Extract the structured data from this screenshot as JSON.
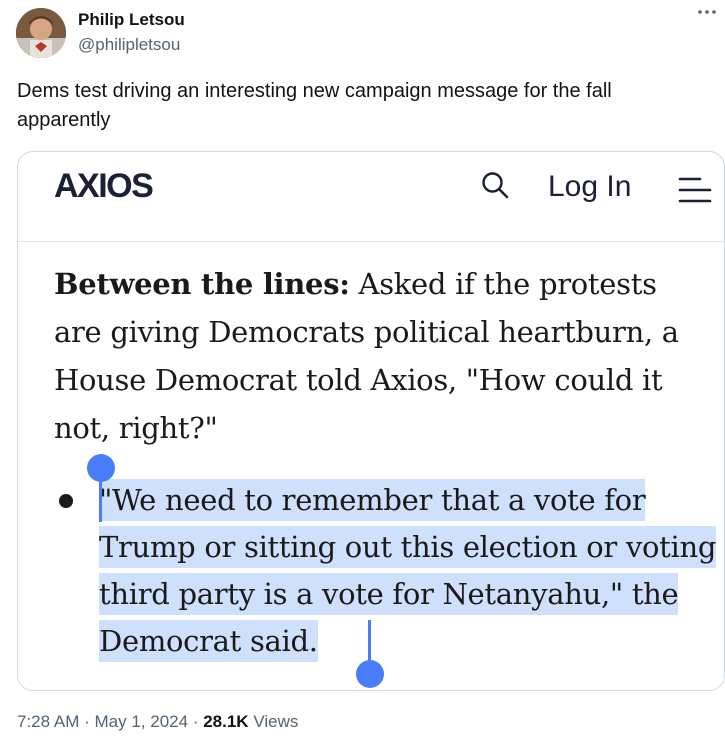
{
  "author": {
    "name": "Philip Letsou",
    "handle": "@philipletsou"
  },
  "tweet": {
    "text": "Dems test driving an interesting new campaign message for the fall apparently"
  },
  "media": {
    "header": {
      "logo": "AXIOS",
      "login_label": "Log In"
    },
    "article": {
      "lead": "Between the lines:",
      "body": " Asked if the protests are giving Democrats political heartburn, a House Democrat told Axios, \"How could it not, right?\""
    },
    "quote": {
      "text": "\"We need to remember that a vote for Trump or sitting out this election or voting third party is a vote for Netanyahu,\" the Democrat said."
    },
    "selection_color": "#cfe0fc",
    "handle_color": "#4a7dfa"
  },
  "meta": {
    "time": "7:28 AM",
    "separator": "·",
    "date": "May 1, 2024",
    "views_count": "28.1K",
    "views_label": "Views"
  },
  "icons": {
    "more": "more-horizontal-icon",
    "search": "search-icon",
    "menu": "menu-icon"
  }
}
